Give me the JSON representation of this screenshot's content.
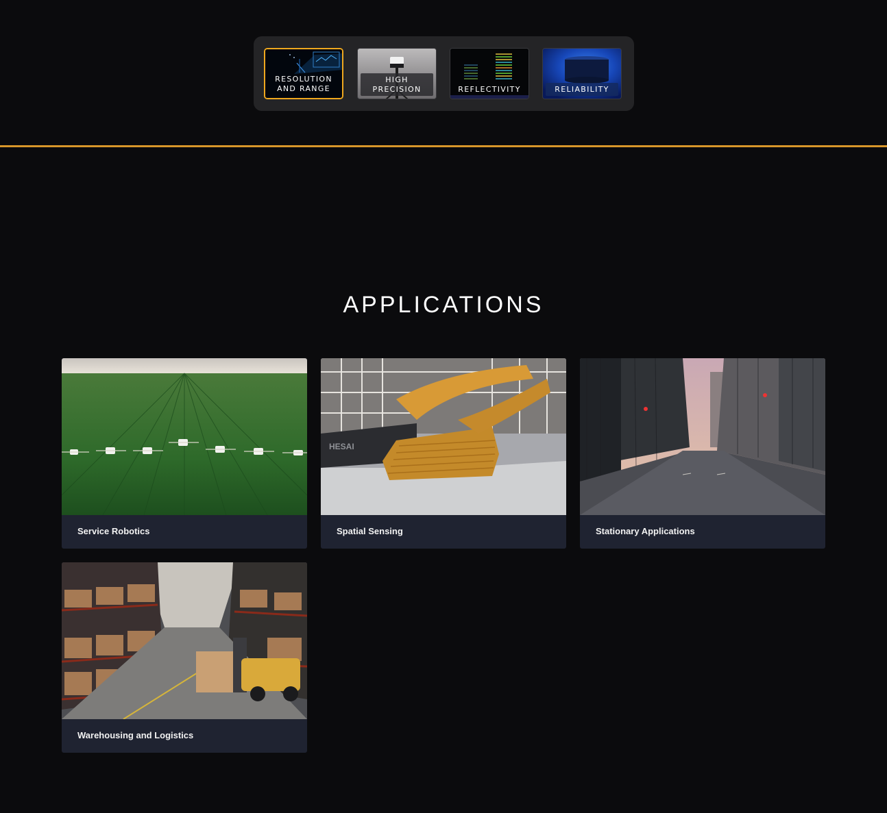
{
  "features": {
    "tabs": [
      {
        "line1": "RESOLUTION",
        "line2": "AND RANGE",
        "active": true
      },
      {
        "line1": "HIGH",
        "line2": "PRECISION",
        "active": false
      },
      {
        "line1": "REFLECTIVITY",
        "line2": "",
        "active": false
      },
      {
        "line1": "RELIABILITY",
        "line2": "",
        "active": false
      }
    ],
    "accent_color": "#f0a81e"
  },
  "divider_color": "#d8962a",
  "applications": {
    "title": "APPLICATIONS",
    "cards": [
      {
        "label": "Service Robotics",
        "image": "crop-field-robots"
      },
      {
        "label": "Spatial Sensing",
        "image": "atrium-staircase"
      },
      {
        "label": "Stationary Applications",
        "image": "city-street"
      },
      {
        "label": "Warehousing and Logistics",
        "image": "warehouse-forklift"
      }
    ]
  },
  "image_texts": {
    "atrium_sign": "HESAI"
  }
}
